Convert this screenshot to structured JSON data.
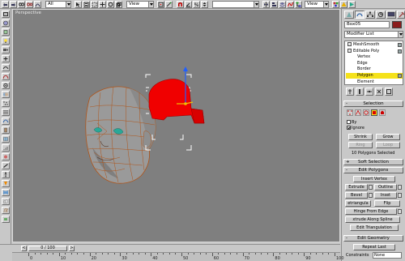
{
  "toolbar": {
    "selection_filter": "All",
    "ref_coord_system": "View",
    "named_selection": "",
    "ref_coord_system_2": "View",
    "icons": [
      "undo-icon",
      "redo-icon",
      "select-link-icon",
      "unlink-icon",
      "bind-space-warp-icon",
      "select-object-icon",
      "select-by-name-icon",
      "rect-region-icon",
      "select-move-icon",
      "select-rotate-icon",
      "select-scale-icon",
      "pivot-center-icon",
      "select-manipulate-icon",
      "snap-icon",
      "angle-snap-icon",
      "percent-snap-icon",
      "spinner-snap-icon",
      "mirror-icon",
      "align-icon",
      "layer-manager-icon",
      "curve-editor-icon",
      "schematic-view-icon",
      "material-editor-icon",
      "render-scene-icon",
      "quick-render-icon"
    ]
  },
  "viewport": {
    "label": "Perspective",
    "background": "#7f7f7f"
  },
  "command_panel": {
    "tabs": [
      "create-tab",
      "modify-tab",
      "hierarchy-tab",
      "motion-tab",
      "display-tab",
      "utilities-tab"
    ],
    "object_name": "Box05",
    "object_color": "#8b1c1c",
    "modifier_list_label": "Modifier List",
    "stack": [
      {
        "label": "MeshSmooth",
        "indent": 0,
        "selected": false,
        "type": "modifier"
      },
      {
        "label": "Editable Poly",
        "indent": 0,
        "selected": false,
        "type": "object"
      },
      {
        "label": "Vertex",
        "indent": 1,
        "selected": false,
        "type": "sub"
      },
      {
        "label": "Edge",
        "indent": 1,
        "selected": false,
        "type": "sub"
      },
      {
        "label": "Border",
        "indent": 1,
        "selected": false,
        "type": "sub"
      },
      {
        "label": "Polygon",
        "indent": 1,
        "selected": true,
        "type": "sub"
      },
      {
        "label": "Element",
        "indent": 1,
        "selected": false,
        "type": "sub"
      }
    ],
    "selection": {
      "title": "Selection",
      "by_vertex": "By",
      "ignore_backfacing": "Ignore",
      "shrink": "Shrink",
      "grow": "Grow",
      "ring": "Ring",
      "loop": "Loop",
      "status": "10 Polygons Selected"
    },
    "soft_selection": {
      "title": "Soft Selection"
    },
    "edit_polygons": {
      "title": "Edit Polygons",
      "insert_vertex": "Insert Vertex",
      "extrude": "Extrude",
      "outline": "Outline",
      "bevel": "Bevel",
      "inset": "Inset",
      "retriangulate": "etriangula",
      "flip": "Flip",
      "hinge_from_edge": "Hinge From Edge",
      "extrude_along_spline": "xtrude Along Spline",
      "edit_triangulation": "Edit Triangulation"
    },
    "edit_geometry": {
      "title": "Edit Geometry",
      "repeat_last": "Repeat Last",
      "constraints_label": "Constraints",
      "constraints_value": "None"
    }
  },
  "time_slider": {
    "thumb_label": "0 / 100",
    "prev": "<",
    "next": ">"
  },
  "trackbar": {
    "ticks": [
      "0",
      "10",
      "20",
      "30",
      "40",
      "50",
      "60",
      "70",
      "80",
      "90",
      "100"
    ]
  }
}
